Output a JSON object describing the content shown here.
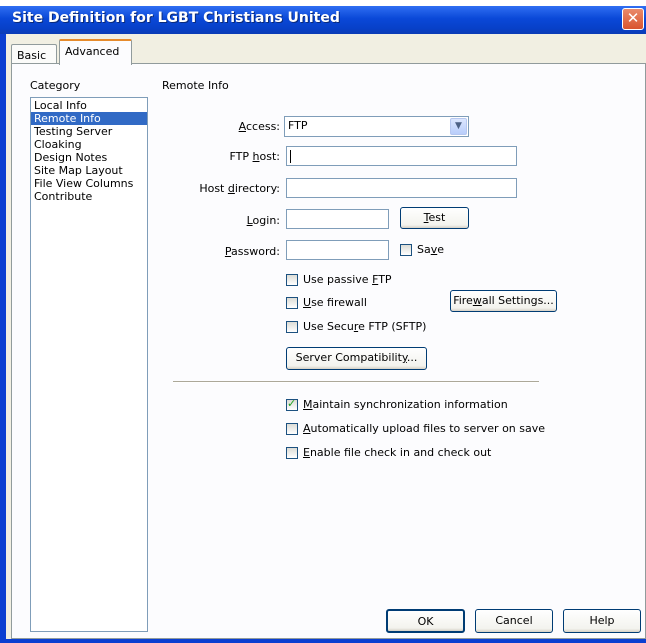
{
  "window": {
    "title": "Site Definition for LGBT Christians United",
    "close_glyph": "✕"
  },
  "tabs": [
    {
      "label": "Basic"
    },
    {
      "label": "Advanced"
    }
  ],
  "category": {
    "label": "Category",
    "items": [
      "Local Info",
      "Remote Info",
      "Testing Server",
      "Cloaking",
      "Design Notes",
      "Site Map Layout",
      "File View Columns",
      "Contribute"
    ],
    "selected": "Remote Info"
  },
  "remote_info": {
    "title": "Remote Info",
    "access": {
      "label_prefix": "",
      "label_accel": "A",
      "label_rest": "ccess:",
      "value": "FTP",
      "arrow": "▼"
    },
    "ftp_host": {
      "label_prefix": "FTP ",
      "label_accel": "h",
      "label_rest": "ost:",
      "value": ""
    },
    "host_directory": {
      "label_prefix": "Host ",
      "label_accel": "d",
      "label_rest": "irectory:",
      "value": ""
    },
    "login": {
      "label_prefix": "",
      "label_accel": "L",
      "label_rest": "ogin:",
      "value": ""
    },
    "password": {
      "label_prefix": "",
      "label_accel": "P",
      "label_rest": "assword:",
      "value": ""
    },
    "test_button": {
      "prefix": "",
      "accel": "T",
      "rest": "est"
    },
    "save": {
      "prefix": "Sa",
      "accel": "v",
      "rest": "e",
      "checked": false
    },
    "passive_ftp": {
      "prefix": "Use passive ",
      "accel": "F",
      "rest": "TP",
      "checked": false
    },
    "use_firewall": {
      "prefix": "",
      "accel": "U",
      "rest": "se firewall",
      "checked": false
    },
    "firewall_settings": {
      "prefix": "Fire",
      "accel": "w",
      "rest": "all Settings..."
    },
    "secure_ftp": {
      "prefix": "Use Secu",
      "accel": "r",
      "rest": "e FTP (SFTP)",
      "checked": false
    },
    "server_compat": {
      "prefix": "Server Compatibilit",
      "accel": "y",
      "rest": "..."
    },
    "maintain_sync": {
      "prefix": "",
      "accel": "M",
      "rest": "aintain synchronization information",
      "checked": true
    },
    "auto_upload": {
      "prefix": "",
      "accel": "A",
      "rest": "utomatically upload files to server on save",
      "checked": false
    },
    "check_in_out": {
      "prefix": "",
      "accel": "E",
      "rest": "nable file check in and check out",
      "checked": false
    }
  },
  "footer": {
    "ok": "OK",
    "cancel": "Cancel",
    "help": "Help"
  },
  "colors": {
    "titlebar": "#0a48d8",
    "selection": "#316ac5",
    "tab_highlight": "#e68b2c"
  }
}
